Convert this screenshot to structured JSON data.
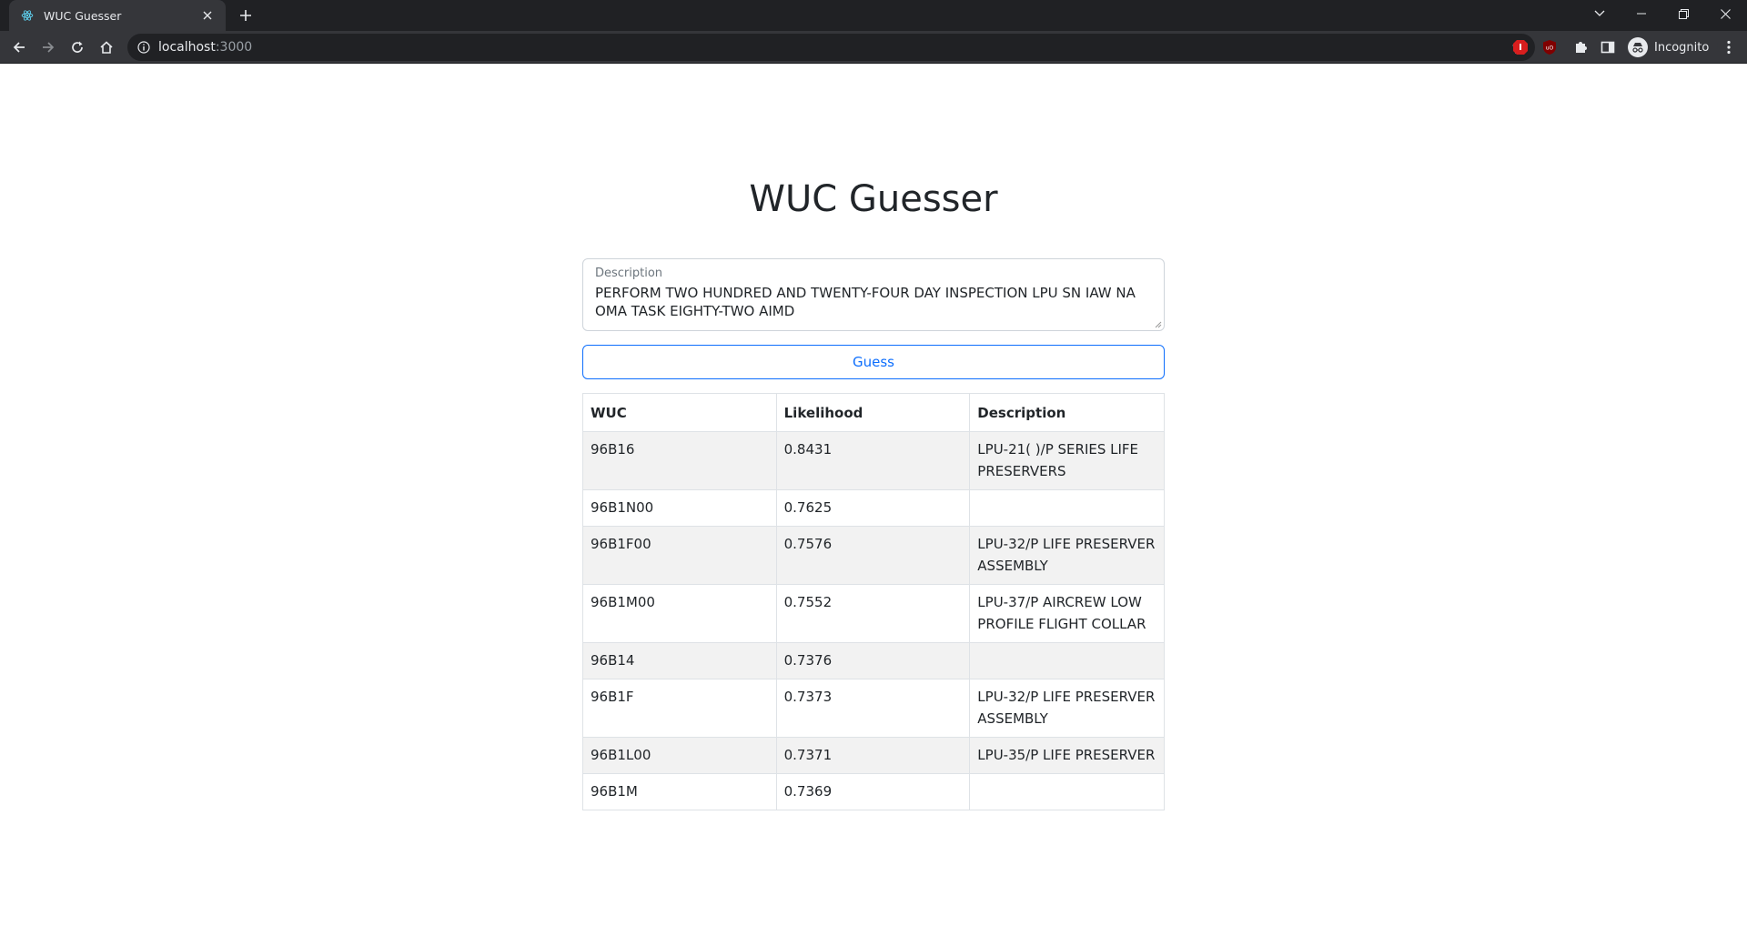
{
  "browser": {
    "tab_title": "WUC Guesser",
    "url_host": "localhost",
    "url_port": ":3000",
    "profile_label": "Incognito",
    "accent_colors": {
      "frame": "#202124",
      "toolbar": "#35363a"
    }
  },
  "page": {
    "title": "WUC Guesser",
    "description_field": {
      "label": "Description",
      "value": "PERFORM TWO HUNDRED AND TWENTY-FOUR DAY INSPECTION LPU SN IAW NA OMA TASK EIGHTY-TWO AIMD"
    },
    "guess_button_label": "Guess",
    "table": {
      "headers": [
        "WUC",
        "Likelihood",
        "Description"
      ],
      "rows": [
        {
          "wuc": "96B16",
          "likelihood": "0.8431",
          "description": "LPU-21( )/P SERIES LIFE PRESERVERS"
        },
        {
          "wuc": "96B1N00",
          "likelihood": "0.7625",
          "description": ""
        },
        {
          "wuc": "96B1F00",
          "likelihood": "0.7576",
          "description": "LPU-32/P LIFE PRESERVER ASSEMBLY"
        },
        {
          "wuc": "96B1M00",
          "likelihood": "0.7552",
          "description": "LPU-37/P AIRCREW LOW PROFILE FLIGHT COLLAR"
        },
        {
          "wuc": "96B14",
          "likelihood": "0.7376",
          "description": ""
        },
        {
          "wuc": "96B1F",
          "likelihood": "0.7373",
          "description": "LPU-32/P LIFE PRESERVER ASSEMBLY"
        },
        {
          "wuc": "96B1L00",
          "likelihood": "0.7371",
          "description": "LPU-35/P LIFE PRESERVER"
        },
        {
          "wuc": "96B1M",
          "likelihood": "0.7369",
          "description": ""
        }
      ]
    },
    "colors": {
      "primary": "#0d6efd",
      "stripe": "#f2f2f2",
      "border": "#dee2e6"
    }
  }
}
